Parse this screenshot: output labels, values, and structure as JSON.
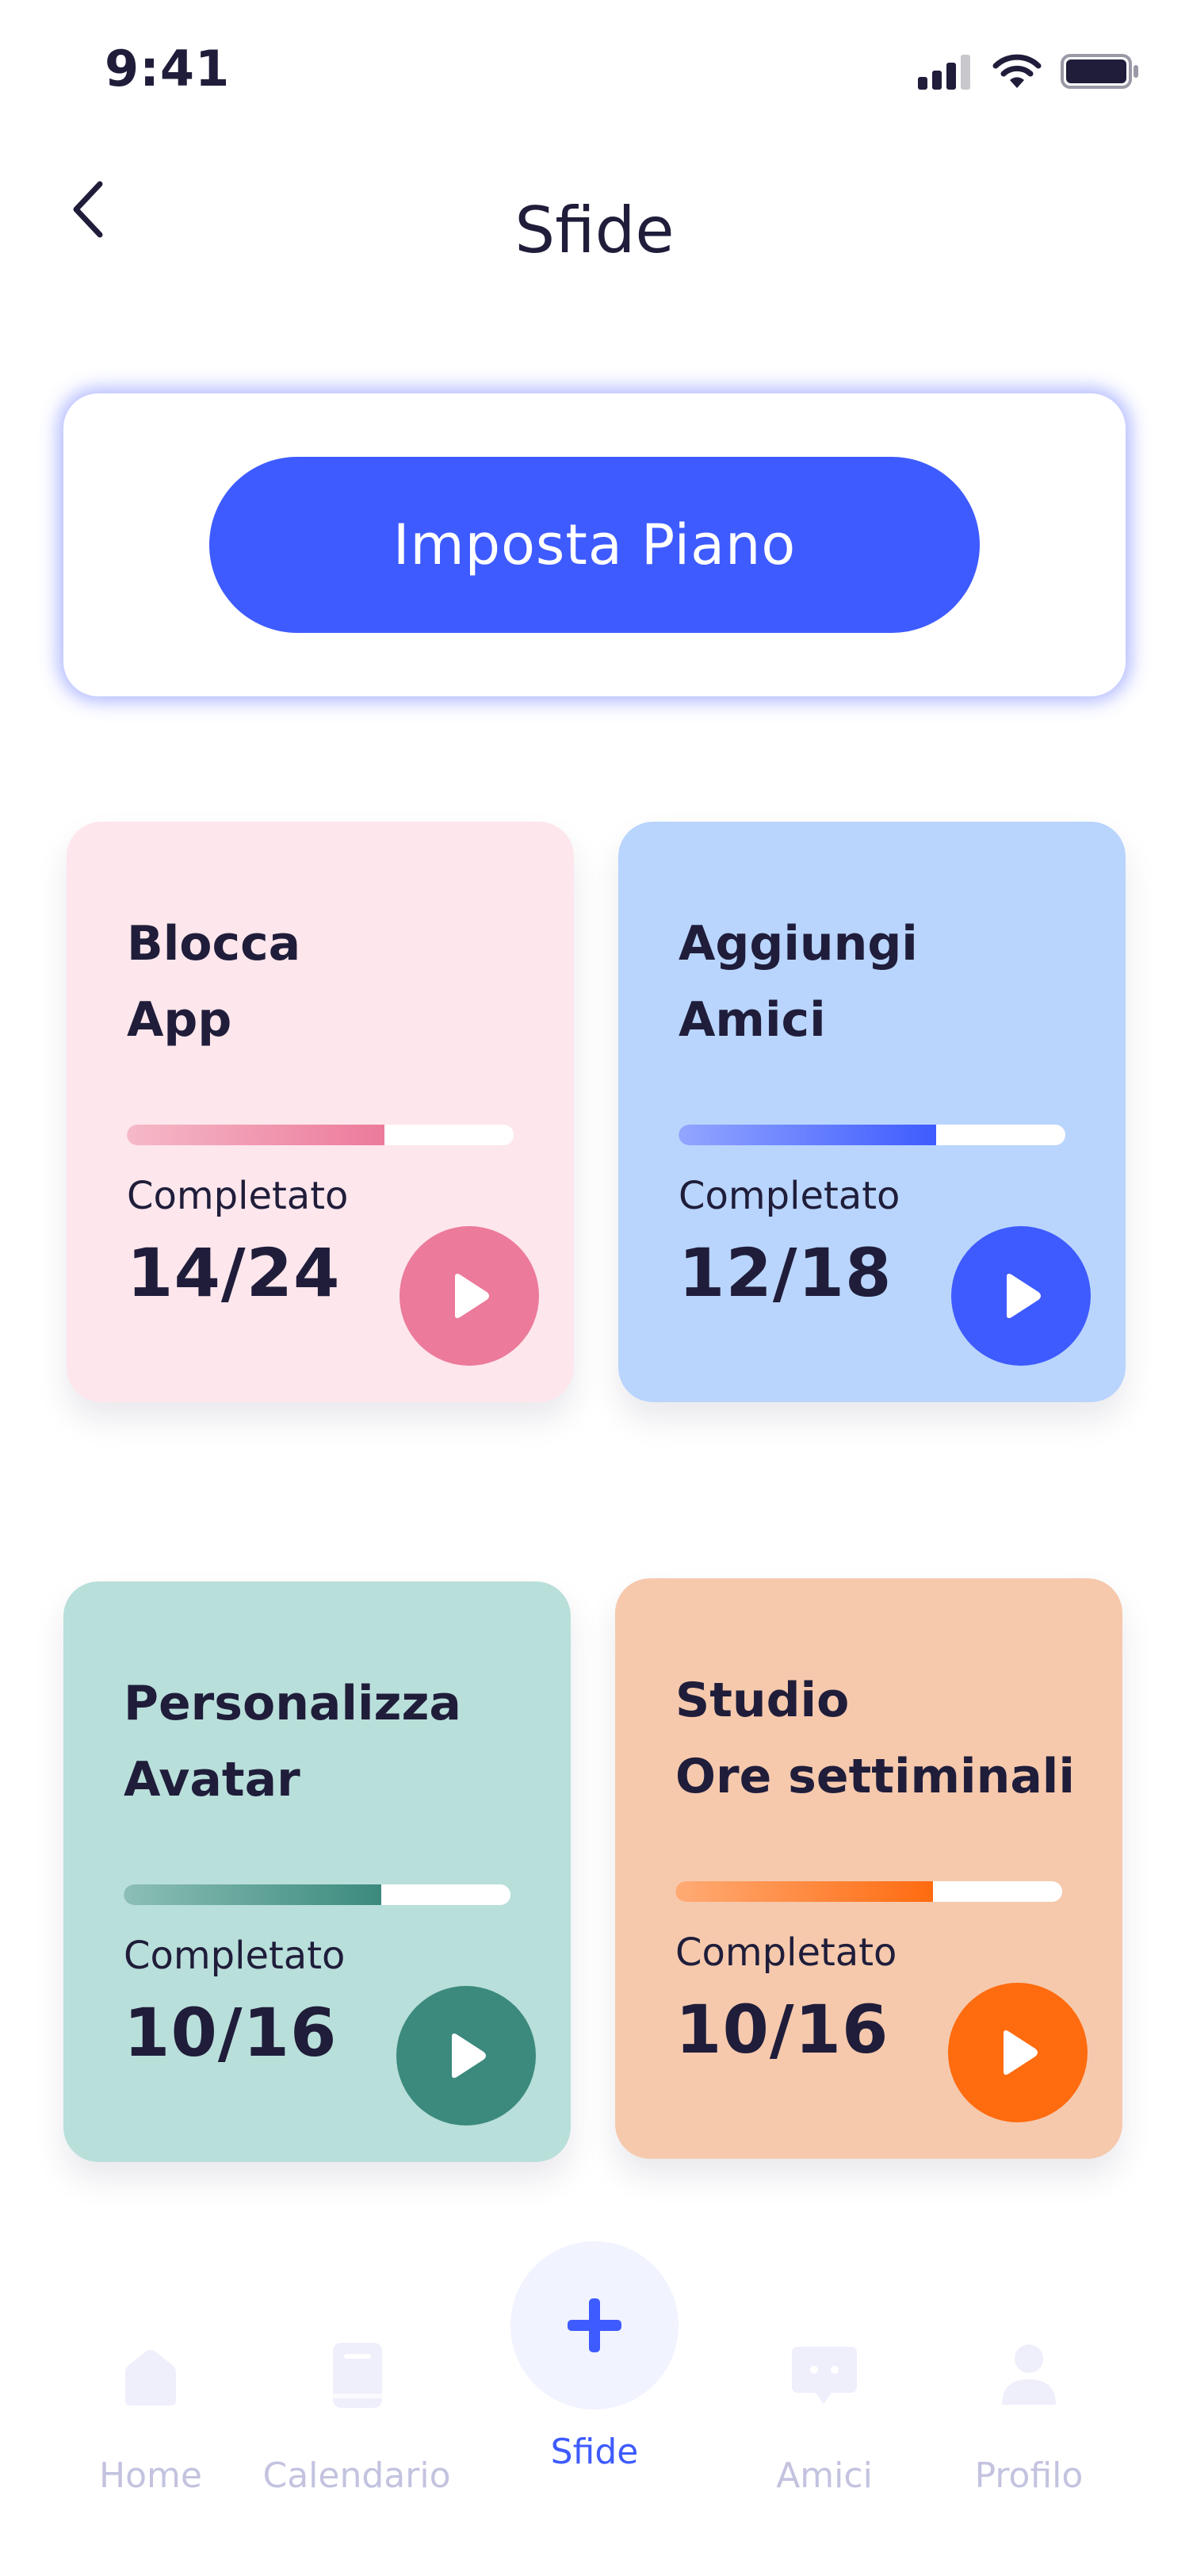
{
  "status_bar": {
    "time": "9:41"
  },
  "header": {
    "title": "Sfide"
  },
  "plan": {
    "button_label": "Imposta Piano"
  },
  "challenges": [
    {
      "title_line1": "Blocca",
      "title_line2": "App",
      "completed_label": "Completato",
      "completed_value": "14/24",
      "progress": 0.6667,
      "bg_color": "#fde6ec",
      "accent_color": "#ec7a9b",
      "accent_light": "#f5b9c8"
    },
    {
      "title_line1": "Aggiungi",
      "title_line2": "Amici",
      "completed_label": "Completato",
      "completed_value": "12/18",
      "progress": 0.6667,
      "bg_color": "#b9d5fd",
      "accent_color": "#3e5bff",
      "accent_light": "#93a6ff"
    },
    {
      "title_line1": "Personalizza",
      "title_line2": "Avatar",
      "completed_label": "Completato",
      "completed_value": "10/16",
      "progress": 0.6667,
      "bg_color": "#b9dfda",
      "accent_color": "#3b8a7d",
      "accent_light": "#8cbfb6"
    },
    {
      "title_line1": "Studio",
      "title_line2": "Ore settiminali",
      "completed_label": "Completato",
      "completed_value": "10/16",
      "progress": 0.6667,
      "bg_color": "#f6c9ad",
      "accent_color": "#ff6b0f",
      "accent_light": "#ffab75"
    }
  ],
  "nav": {
    "items": [
      {
        "label": "Home",
        "icon": "home-icon"
      },
      {
        "label": "Calendario",
        "icon": "book-icon"
      },
      {
        "label": "Sfide",
        "icon": "plus-icon"
      },
      {
        "label": "Amici",
        "icon": "chat-icon"
      },
      {
        "label": "Profilo",
        "icon": "user-icon"
      }
    ],
    "active_color": "#3e5bff",
    "inactive_color": "#c3c3e0"
  }
}
